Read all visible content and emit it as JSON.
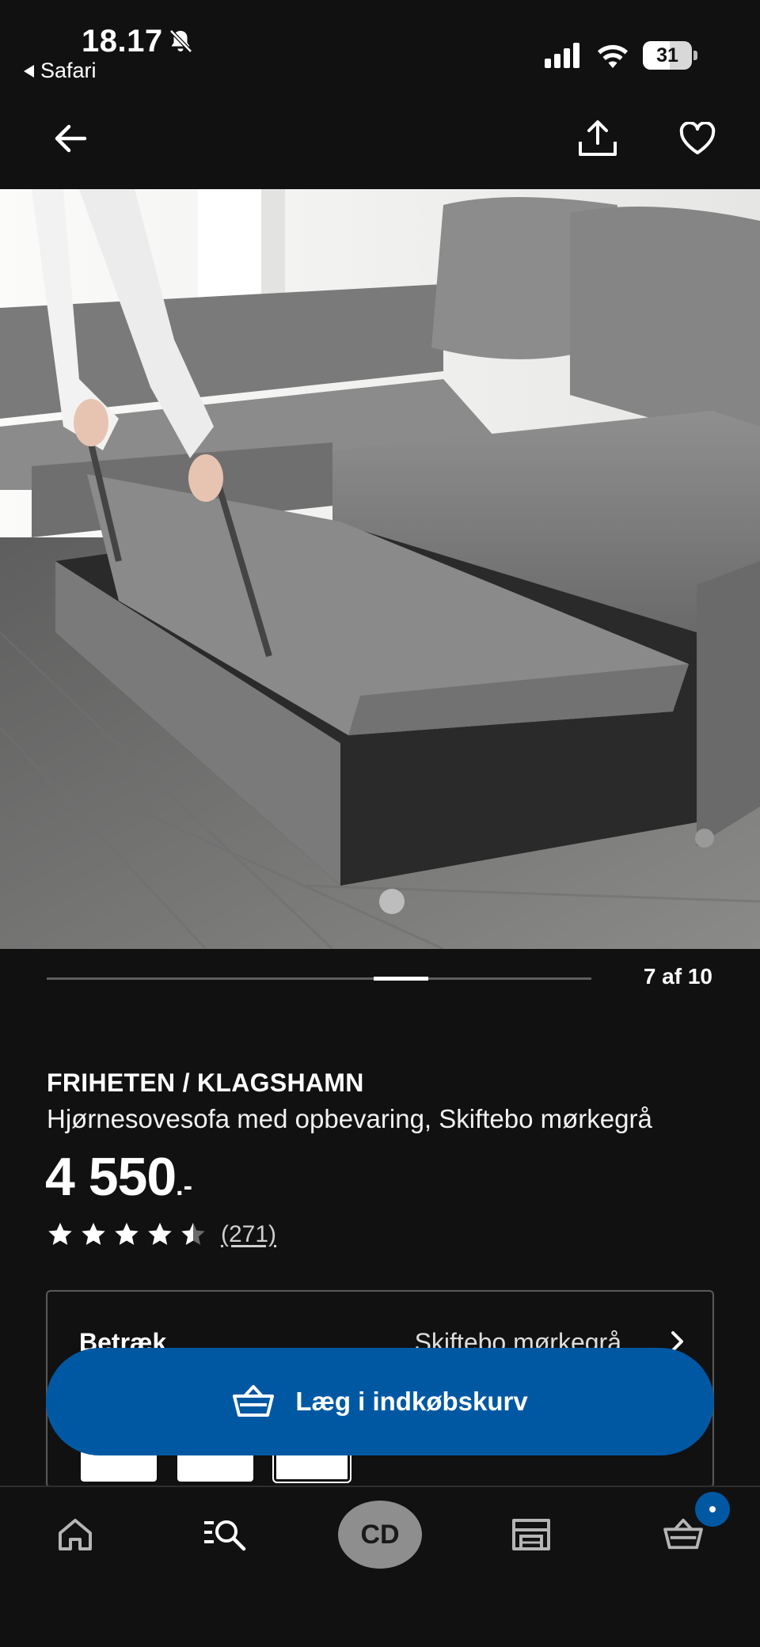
{
  "status_bar": {
    "time": "18.17",
    "back_app": "Safari",
    "battery": "31"
  },
  "header": {
    "back_icon": "arrow-left-icon",
    "share_icon": "share-icon",
    "favorite_icon": "heart-icon"
  },
  "gallery": {
    "counter": "7 af 10",
    "current_index": 7,
    "total": 10
  },
  "product": {
    "name": "FRIHETEN / KLAGSHAMN",
    "description": "Hjørnesovesofa med opbevaring, Skiftebo mørkegrå",
    "price": "4 550",
    "price_suffix": ".-",
    "rating": 4.5,
    "review_count": "(271)"
  },
  "options": {
    "label": "Betræk",
    "value": "Skiftebo mørkegrå"
  },
  "cta": {
    "label": "Læg i indkøbskurv",
    "icon": "basket-icon",
    "color": "#0058a3"
  },
  "bottom_nav": {
    "items": [
      {
        "name": "home",
        "icon": "home-icon"
      },
      {
        "name": "search",
        "icon": "search-list-icon"
      },
      {
        "name": "profile",
        "icon": "avatar",
        "label": "CD"
      },
      {
        "name": "store",
        "icon": "store-icon"
      },
      {
        "name": "cart",
        "icon": "basket-icon"
      }
    ],
    "avatar_initials": "CD"
  }
}
